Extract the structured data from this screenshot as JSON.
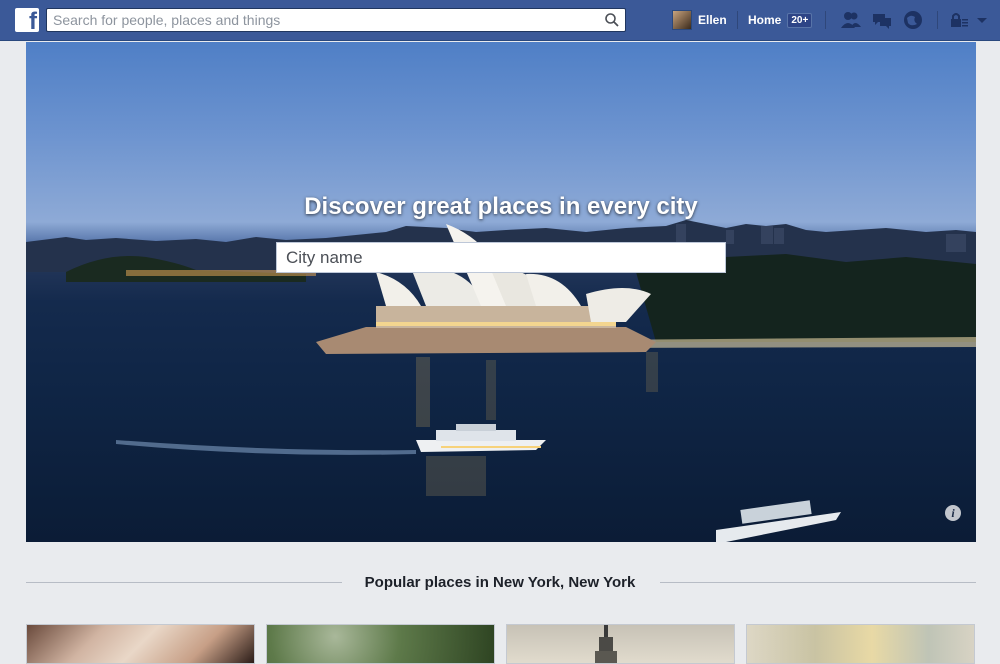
{
  "topbar": {
    "search_placeholder": "Search for people, places and things",
    "user_name": "Ellen",
    "home_label": "Home",
    "home_badge": "20+",
    "brand_color": "#3b5998"
  },
  "hero": {
    "title": "Discover great places in every city",
    "city_placeholder": "City name",
    "info_glyph": "i"
  },
  "popular": {
    "title": "Popular places in New York, New York",
    "cards": [
      {
        "name": "place-card-1"
      },
      {
        "name": "place-card-2"
      },
      {
        "name": "place-card-3"
      },
      {
        "name": "place-card-4"
      }
    ]
  },
  "icons": [
    "facebook-logo-icon",
    "search-icon",
    "friend-requests-icon",
    "messages-icon",
    "notifications-icon",
    "privacy-shortcuts-icon",
    "chevron-down-icon",
    "info-icon"
  ]
}
